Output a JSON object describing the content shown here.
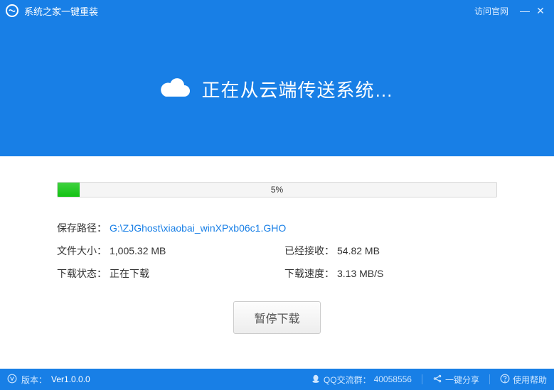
{
  "titlebar": {
    "app_name": "系统之家一键重装",
    "official_link": "访问官网"
  },
  "header": {
    "status_text": "正在从云端传送系统…"
  },
  "progress": {
    "percent_label": "5%",
    "percent_value": 5
  },
  "details": {
    "save_path_label": "保存路径：",
    "save_path_value": "G:\\ZJGhost\\xiaobai_winXPxb06c1.GHO",
    "file_size_label": "文件大小：",
    "file_size_value": "1,005.32 MB",
    "received_label": "已经接收：",
    "received_value": "54.82 MB",
    "dl_state_label": "下载状态：",
    "dl_state_value": "正在下载",
    "dl_speed_label": "下载速度：",
    "dl_speed_value": "3.13 MB/S"
  },
  "buttons": {
    "pause": "暂停下载"
  },
  "statusbar": {
    "version_label": "版本：",
    "version_value": "Ver1.0.0.0",
    "qq_label": "QQ交流群：",
    "qq_value": "40058556",
    "share_label": "一键分享",
    "help_label": "使用帮助"
  }
}
